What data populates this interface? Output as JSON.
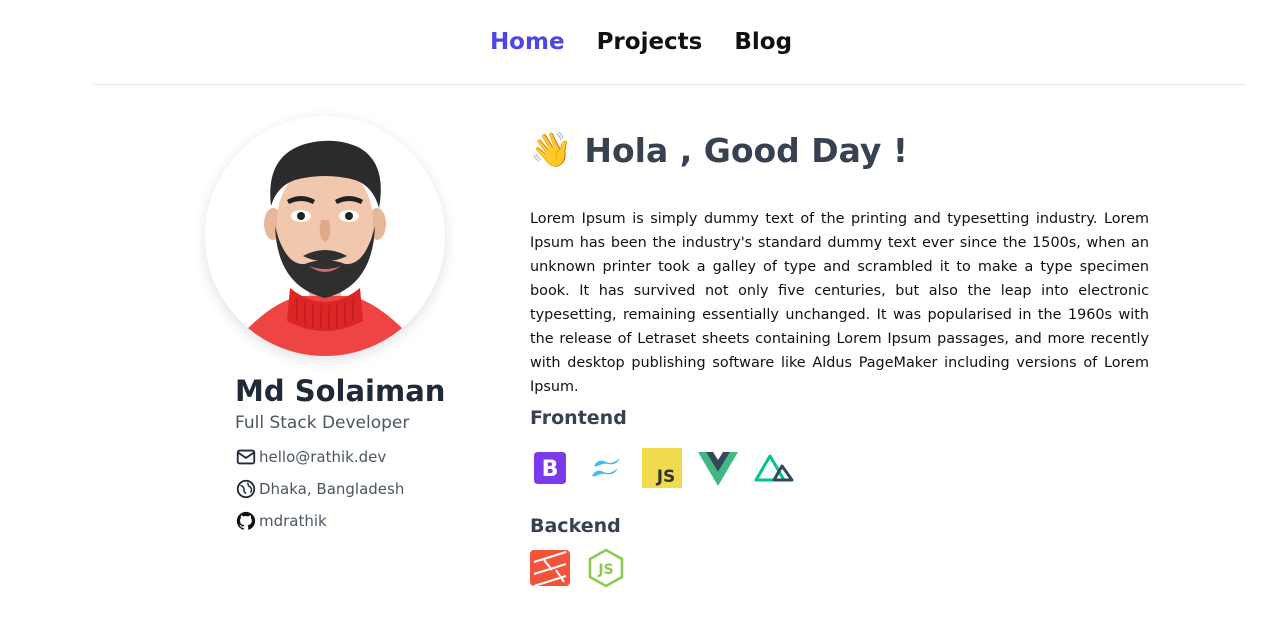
{
  "nav": {
    "items": [
      {
        "label": "Home",
        "active": true
      },
      {
        "label": "Projects",
        "active": false
      },
      {
        "label": "Blog",
        "active": false
      }
    ],
    "active_color": "#4f46e5"
  },
  "profile": {
    "name": "Md Solaiman",
    "role": "Full Stack Developer",
    "email": "hello@rathik.dev",
    "location": "Dhaka, Bangladesh",
    "github": "mdrathik"
  },
  "main": {
    "greeting_emoji": "👋",
    "greeting": "Hola , Good Day !",
    "bio": "Lorem Ipsum is simply dummy text of the printing and typesetting industry. Lorem Ipsum has been the industry's standard dummy text ever since the 1500s, when an unknown printer took a galley of type and scrambled it to make a type specimen book. It has survived not only five centuries, but also the leap into electronic typesetting, remaining essentially unchanged. It was popularised in the 1960s with the release of Letraset sheets containing Lorem Ipsum passages, and more recently with desktop publishing software like Aldus PageMaker including versions of Lorem Ipsum.",
    "frontend_title": "Frontend",
    "frontend_icons": [
      "bootstrap-icon",
      "tailwind-icon",
      "javascript-icon",
      "vue-icon",
      "nuxt-icon"
    ],
    "backend_title": "Backend",
    "backend_icons": [
      "laravel-icon",
      "nodejs-icon"
    ]
  }
}
